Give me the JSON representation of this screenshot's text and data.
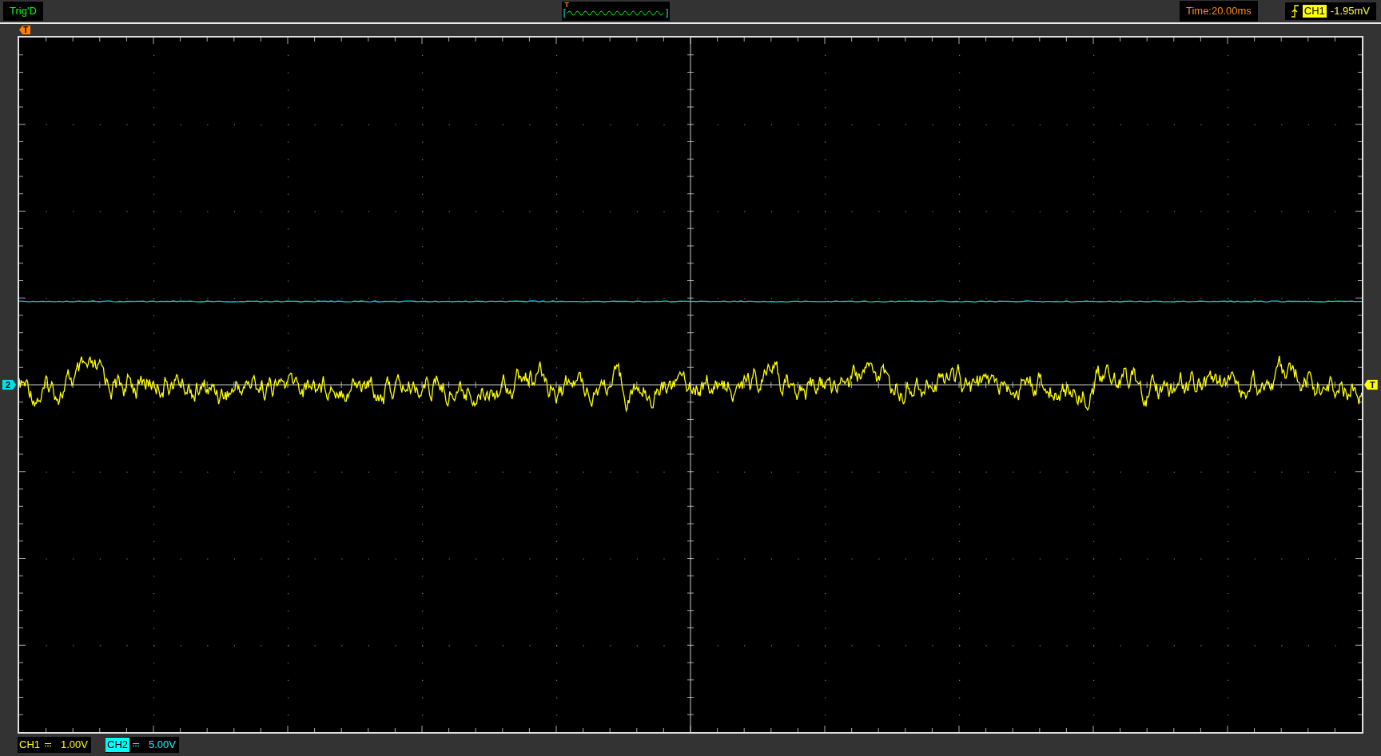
{
  "status": {
    "text": "Trig'D"
  },
  "trigger_preview": {
    "marker": "T"
  },
  "timebase": {
    "text": "Time:20.00ms"
  },
  "trigger": {
    "source": "CH1",
    "reading": "-1.95mV"
  },
  "trigger_position_marker": "T",
  "channel_marker": "2",
  "trigger_level_marker": "T",
  "channels": [
    {
      "name": "CH1",
      "scale": "1.00V",
      "selected": false,
      "color": "#ffff00"
    },
    {
      "name": "CH2",
      "scale": "5.00V",
      "selected": true,
      "color": "#00ffff"
    }
  ]
}
